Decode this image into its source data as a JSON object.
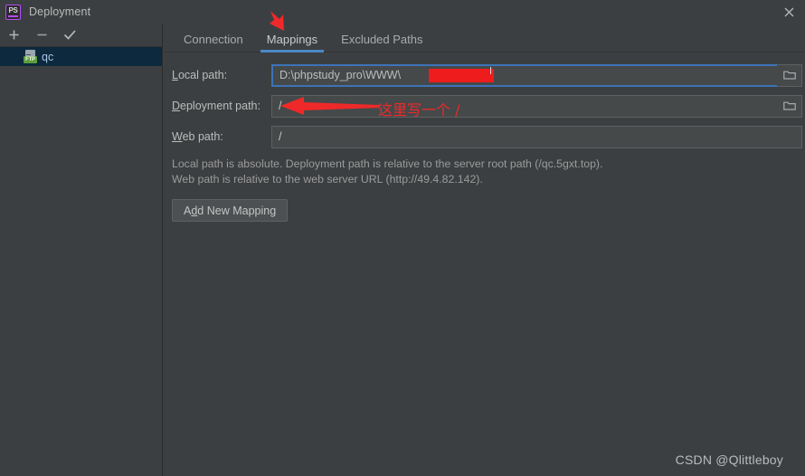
{
  "window": {
    "title": "Deployment",
    "logo_text": "PS",
    "close_icon": "close-icon"
  },
  "sidebar": {
    "toolbar": [
      {
        "name": "add-server-button",
        "icon": "plus-icon",
        "label": "+"
      },
      {
        "name": "remove-server-button",
        "icon": "minus-icon",
        "label": "−"
      },
      {
        "name": "set-default-server-button",
        "icon": "check-icon",
        "label": "✓"
      }
    ],
    "items": [
      {
        "label": "qc",
        "icon": "ftp-server-icon",
        "badge": "FTP",
        "selected": true
      }
    ]
  },
  "tabs": [
    {
      "label": "Connection",
      "active": false
    },
    {
      "label": "Mappings",
      "active": true
    },
    {
      "label": "Excluded Paths",
      "active": false
    }
  ],
  "form": {
    "local_path": {
      "label_mnemonic": "L",
      "label_rest": "ocal path:",
      "value": "D:\\phpstudy_pro\\WWW\\",
      "redacted": true,
      "focused": true,
      "browse_icon": "folder-icon"
    },
    "deployment_path": {
      "label_mnemonic": "D",
      "label_rest": "eployment path:",
      "value": "/",
      "browse_icon": "folder-icon"
    },
    "web_path": {
      "label_mnemonic": "W",
      "label_rest": "eb path:",
      "value": "/"
    },
    "help_line1": "Local path is absolute. Deployment path is relative to the server root path (/qc.5gxt.top).",
    "help_line2": "Web path is relative to the web server URL (http://49.4.82.142).",
    "add_mapping_button": {
      "prefix": "A",
      "mnemonic": "d",
      "suffix": "d New Mapping"
    }
  },
  "annotations": {
    "note_text": "这里写一个 /",
    "arrow_color": "#ef2929",
    "arrow_to_field": "arrow-left-icon",
    "arrow_to_tab": "arrow-down-icon"
  },
  "watermark": "CSDN @Qlittleboy",
  "colors": {
    "background": "#3c3f41",
    "field_background": "#45494a",
    "accent_tab_underline": "#4a88c7",
    "focus_border": "#3d73b8",
    "selection": "#0d293e",
    "annotation_red": "#ef2929",
    "redaction_red": "#ee1c1c",
    "logo_purple": "#b74af7",
    "ftp_badge_green": "#5a9e3a"
  }
}
